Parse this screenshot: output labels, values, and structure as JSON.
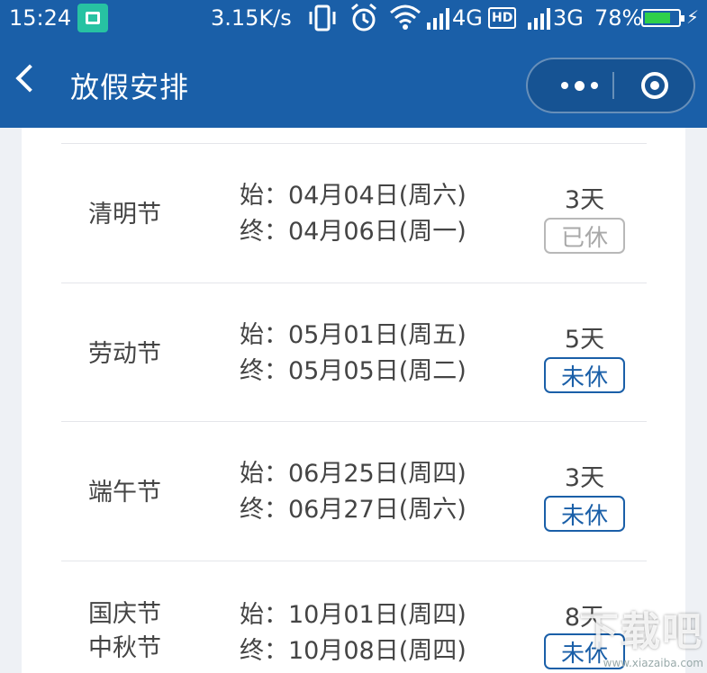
{
  "status_bar": {
    "time": "15:24",
    "network_speed": "3.15K/s",
    "network_4g": "4G",
    "hd_label": "HD",
    "network_3g": "3G",
    "battery_percent": "78%",
    "battery_level": 0.78,
    "accent_color": "#27c2a2"
  },
  "nav": {
    "title": "放假安排",
    "background_color": "#1a5fa8"
  },
  "holidays": [
    {
      "names": [
        "清明节"
      ],
      "start": "始：04月04日(周六)",
      "end": "终：04月06日(周一)",
      "days": "3天",
      "status": "已休",
      "status_type": "done"
    },
    {
      "names": [
        "劳动节"
      ],
      "start": "始：05月01日(周五)",
      "end": "终：05月05日(周二)",
      "days": "5天",
      "status": "未休",
      "status_type": "todo"
    },
    {
      "names": [
        "端午节"
      ],
      "start": "始：06月25日(周四)",
      "end": "终：06月27日(周六)",
      "days": "3天",
      "status": "未休",
      "status_type": "todo"
    },
    {
      "names": [
        "国庆节",
        "中秋节"
      ],
      "start": "始：10月01日(周四)",
      "end": "终：10月08日(周四)",
      "days": "8天",
      "status": "未休",
      "status_type": "todo"
    }
  ],
  "watermark": {
    "text": "下载吧",
    "url_text": "www.xiazaiba.com"
  }
}
